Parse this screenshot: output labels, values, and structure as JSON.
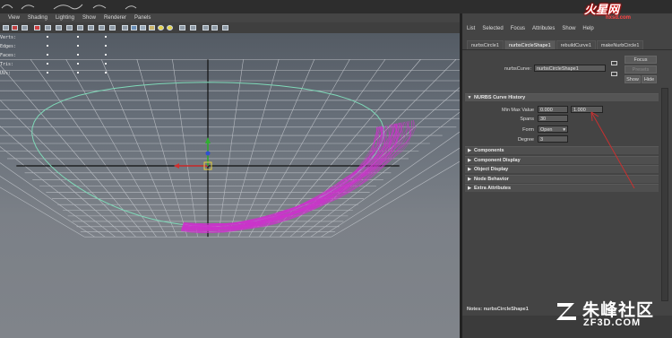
{
  "window": {
    "topstrip": ""
  },
  "viewport": {
    "menu": [
      "View",
      "Shading",
      "Lighting",
      "Show",
      "Renderer",
      "Panels"
    ],
    "hud_labels": [
      "Verts:",
      "Edges:",
      "Faces:",
      "Tris:",
      "UVs:"
    ],
    "colors": {
      "circle": "#7fd9b8",
      "fur": "#cc33cc",
      "grid": "#b8bcc2",
      "axis": "#111111"
    }
  },
  "attribute_editor": {
    "menu": [
      "List",
      "Selected",
      "Focus",
      "Attributes",
      "Show",
      "Help"
    ],
    "tabs": [
      "nurbsCircle1",
      "nurbsCircleShape1",
      "rebuildCurve1",
      "makeNurbCircle1"
    ],
    "active_tab": 1,
    "node_label": "nurbsCurve:",
    "node_value": "nurbsCircleShape1",
    "buttons": {
      "focus": "Focus",
      "presets": "Presets",
      "show": "Show",
      "hide": "Hide"
    },
    "history_section": "NURBS Curve History",
    "min_max_label": "Min Max Value",
    "min_value": "0.000",
    "max_value": "1.000",
    "spans_label": "Spans",
    "spans_value": "30",
    "form_label": "Form",
    "form_value": "Open",
    "degree_label": "Degree",
    "degree_value": "3",
    "sections": [
      "Components",
      "Component Display",
      "Object Display",
      "Node Behavior",
      "Extra Attributes"
    ],
    "notes": "Notes: nurbsCircleShape1"
  },
  "watermark": {
    "top_text": "火星网",
    "top_url": "hxsd.com",
    "bottom_text": "朱峰社区",
    "bottom_url": "ZF3D.COM"
  }
}
